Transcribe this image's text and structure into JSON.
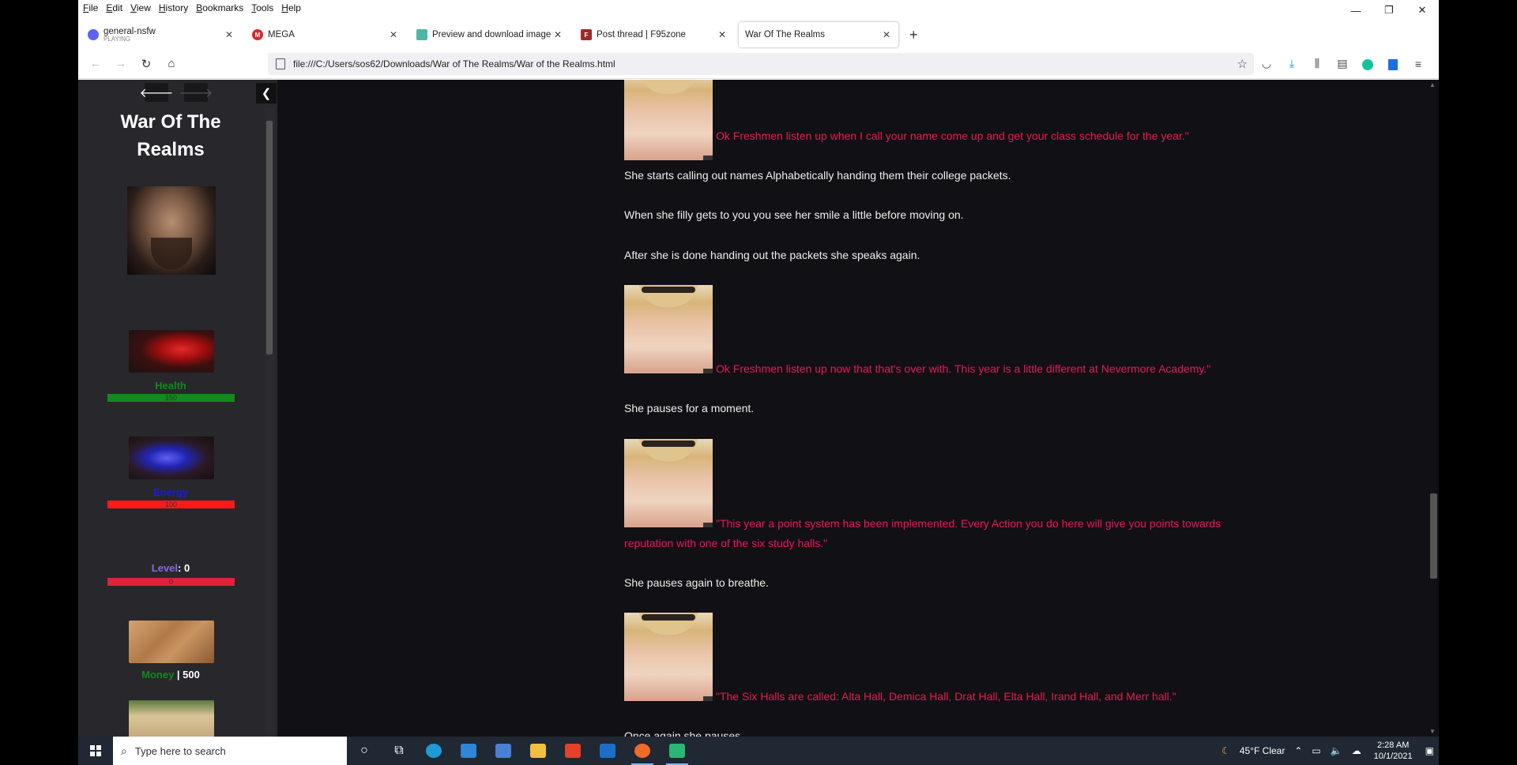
{
  "menu": [
    "File",
    "Edit",
    "View",
    "History",
    "Bookmarks",
    "Tools",
    "Help"
  ],
  "window_controls": {
    "minimize": "—",
    "restore": "❐",
    "close": "✕"
  },
  "tabs": [
    {
      "label": "general-nsfw",
      "sub": "PLAYING",
      "favicon_color": "#5865f2",
      "favicon_text": "",
      "active": false
    },
    {
      "label": "MEGA",
      "sub": "",
      "favicon_color": "#d9272e",
      "favicon_text": "M",
      "active": false
    },
    {
      "label": "Preview and download image | ",
      "sub": "",
      "favicon_color": "#4ab7a8",
      "favicon_text": "",
      "active": false
    },
    {
      "label": "Post thread | F95zone",
      "sub": "",
      "favicon_color": "#9b2b2b",
      "favicon_text": "F",
      "active": false
    },
    {
      "label": "War Of The Realms",
      "sub": "",
      "favicon_color": "",
      "favicon_text": "",
      "active": true
    }
  ],
  "new_tab": "+",
  "url": "file:///C:/Users/sos62/Downloads/War of The Realms/War of the Realms.html",
  "sidebar": {
    "title": "War Of The Realms",
    "health": {
      "label": "Health",
      "value": "150",
      "color": "#138a1e",
      "fraction": 1.0
    },
    "energy": {
      "label": "Energy",
      "value": "100",
      "color": "#1a1ae0",
      "bar_color": "#ff1a1a",
      "fraction": 1.0
    },
    "level": {
      "label": "Level",
      "sep": ": ",
      "value": "0",
      "color": "#8a6ad8",
      "bar_value": "0",
      "bar_color": "#e0223a"
    },
    "money": {
      "label": "Money",
      "sep": " | ",
      "value": "500",
      "color": "#138a1e"
    }
  },
  "content_lines": [
    {
      "type": "speech",
      "text": "Ok Freshmen listen up when I call your name come up and get your class schedule for the year.\""
    },
    {
      "type": "narr",
      "text": "She starts calling out names Alphabetically handing them their college packets."
    },
    {
      "type": "narr",
      "text": "When she filly gets to you you see her smile a little before moving on."
    },
    {
      "type": "narr",
      "text": "After she is done handing out the packets she speaks again."
    },
    {
      "type": "speech",
      "text": "Ok Freshmen listen up now that that's over with. This year is a little different at Nevermore Academy.\""
    },
    {
      "type": "narr",
      "text": "She pauses for a moment."
    },
    {
      "type": "speech",
      "text": "\"This year a point system has been implemented. Every Action you do here will give you points towards"
    },
    {
      "type": "speech",
      "text": "reputation with one of the six study halls.\""
    },
    {
      "type": "narr",
      "text": "She pauses again to breathe."
    },
    {
      "type": "speech",
      "text": "\"The Six Halls are called: Alta Hall, Demica Hall, Drat Hall, Elta Hall, Irand Hall, and Merr hall.\""
    },
    {
      "type": "narr",
      "text": "Once again she pauses."
    }
  ],
  "taskbar": {
    "search_placeholder": "Type here to search",
    "weather": "45°F  Clear",
    "time": "2:28 AM",
    "date": "10/1/2021"
  }
}
